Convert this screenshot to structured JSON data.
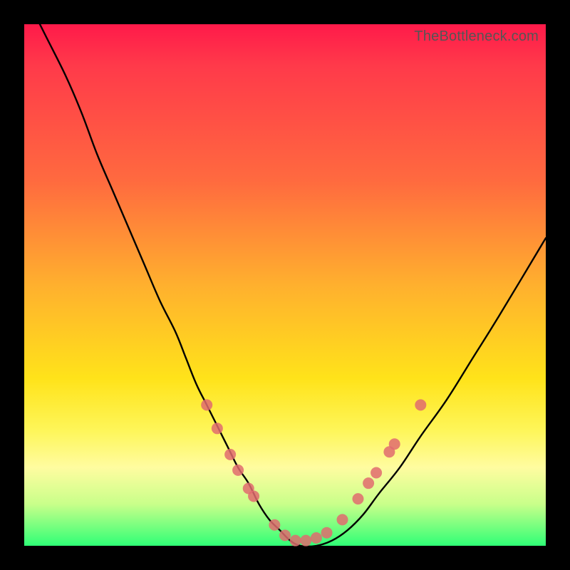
{
  "watermark": "TheBottleneck.com",
  "chart_data": {
    "type": "line",
    "title": "",
    "xlabel": "",
    "ylabel": "",
    "xlim": [
      0,
      100
    ],
    "ylim": [
      0,
      100
    ],
    "series": [
      {
        "name": "bottleneck-curve",
        "x": [
          0,
          4,
          8,
          11,
          14,
          17,
          20,
          23,
          26,
          29,
          31,
          33,
          35,
          37,
          39,
          41,
          43,
          45,
          47,
          49,
          51,
          53,
          56,
          59,
          62,
          65,
          68,
          72,
          76,
          81,
          86,
          91,
          100
        ],
        "values": [
          106,
          98,
          90,
          83,
          75,
          68,
          61,
          54,
          47,
          41,
          36,
          31,
          27,
          23,
          19,
          15,
          12,
          8,
          5,
          3,
          1,
          0,
          0,
          1,
          3,
          6,
          10,
          15,
          21,
          28,
          36,
          44,
          59
        ]
      }
    ],
    "markers": {
      "name": "highlight-dots",
      "color": "#e06b6f",
      "radius_px": 8,
      "points": [
        {
          "x": 35.0,
          "y": 27.0
        },
        {
          "x": 37.0,
          "y": 22.5
        },
        {
          "x": 39.5,
          "y": 17.5
        },
        {
          "x": 41.0,
          "y": 14.5
        },
        {
          "x": 43.0,
          "y": 11.0
        },
        {
          "x": 44.0,
          "y": 9.5
        },
        {
          "x": 48.0,
          "y": 4.0
        },
        {
          "x": 50.0,
          "y": 2.0
        },
        {
          "x": 52.0,
          "y": 1.0
        },
        {
          "x": 54.0,
          "y": 1.0
        },
        {
          "x": 56.0,
          "y": 1.5
        },
        {
          "x": 58.0,
          "y": 2.5
        },
        {
          "x": 61.0,
          "y": 5.0
        },
        {
          "x": 64.0,
          "y": 9.0
        },
        {
          "x": 66.0,
          "y": 12.0
        },
        {
          "x": 67.5,
          "y": 14.0
        },
        {
          "x": 70.0,
          "y": 18.0
        },
        {
          "x": 71.0,
          "y": 19.5
        },
        {
          "x": 76.0,
          "y": 27.0
        }
      ]
    },
    "colors": {
      "background_top": "#ff1a4a",
      "background_bottom": "#2fff76",
      "curve": "#000000",
      "frame": "#000000",
      "marker": "#e06b6f"
    }
  }
}
